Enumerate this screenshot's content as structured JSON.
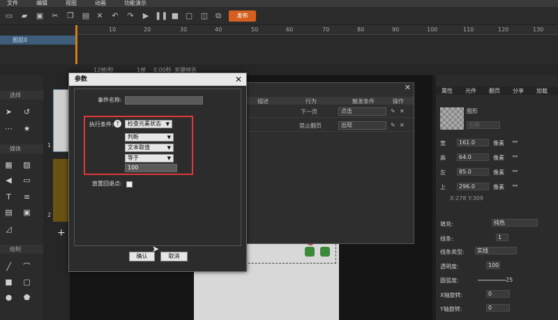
{
  "menu": [
    "文件",
    "编辑",
    "视图",
    "动画",
    "功能演示"
  ],
  "toolbar": {
    "publish_label": "发布"
  },
  "timeline": {
    "ticks": [
      "10",
      "20",
      "30",
      "40",
      "50",
      "60",
      "70",
      "80",
      "90",
      "100",
      "110",
      "120",
      "130"
    ],
    "layer_name": "图层0",
    "status": [
      "12帧/秒",
      "1帧",
      "0.00秒",
      "关键帧名"
    ]
  },
  "left_panel": {
    "select_header": "选择",
    "media_header": "媒体",
    "draw_header": "绘制"
  },
  "slides": [
    "1",
    "2"
  ],
  "right_panel": {
    "tabs": [
      "属性",
      "元件",
      "翻页",
      "分享",
      "加载"
    ],
    "element_label": "图形",
    "name_placeholder": "名称",
    "width_label": "宽",
    "width_value": "161.0",
    "height_label": "高",
    "height_value": "64.0",
    "left_label": "左",
    "left_value": "85.0",
    "top_label": "上",
    "top_value": "296.0",
    "unit": "像素",
    "coords": "X:278   Y:309",
    "fill_label": "填充:",
    "fill_value": "纯色",
    "line_label": "线条:",
    "line_width": "1",
    "line_type_label": "线条类型:",
    "line_type_value": "实线",
    "opacity_label": "透明度:",
    "opacity_value": "100",
    "corner_label": "圆弧度:",
    "corner_value": "25",
    "xrot_label": "X轴旋转:",
    "xrot_value": "0",
    "yrot_label": "Y轴旋转:",
    "yrot_value": "0"
  },
  "bg_dialog": {
    "headers": [
      "描述",
      "行为",
      "触发条件",
      "操作"
    ],
    "rows": [
      {
        "action": "下一页",
        "trigger": "点击"
      },
      {
        "action": "禁止翻页",
        "trigger": "出现"
      }
    ]
  },
  "modal": {
    "title": "参数",
    "event_name_label": "事件名称:",
    "event_name_value": "",
    "condition_label": "执行条件:",
    "condition_value": "检查元素状态",
    "judge_value": "判断",
    "text_value_option": "文本取值",
    "equals_value": "等于",
    "compare_value": "100",
    "rollback_label": "放置回退点:",
    "ok_label": "确认",
    "cancel_label": "取消"
  }
}
